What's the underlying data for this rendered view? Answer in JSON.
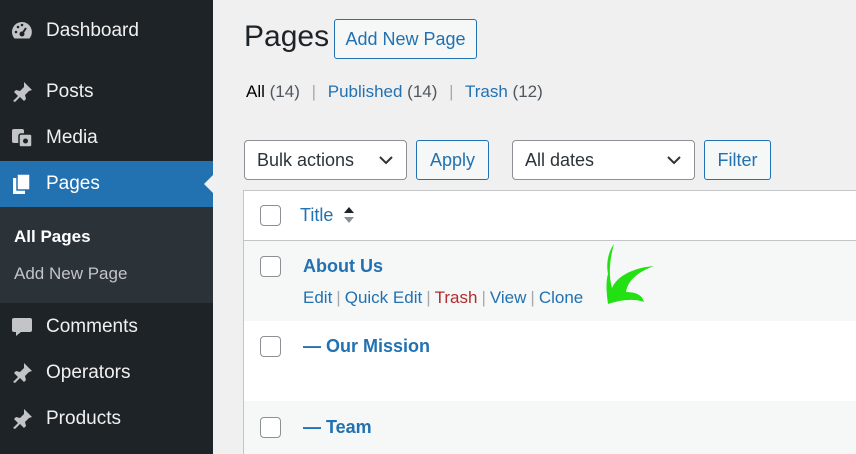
{
  "sidebar": {
    "items": [
      {
        "label": "Dashboard",
        "icon": "dashboard-icon"
      },
      {
        "label": "Posts",
        "icon": "pin-icon"
      },
      {
        "label": "Media",
        "icon": "media-icon"
      },
      {
        "label": "Pages",
        "icon": "pages-icon"
      },
      {
        "label": "Comments",
        "icon": "comment-icon"
      },
      {
        "label": "Operators",
        "icon": "pin-icon"
      },
      {
        "label": "Products",
        "icon": "pin-icon"
      }
    ],
    "submenu": [
      {
        "label": "All Pages"
      },
      {
        "label": "Add New Page"
      }
    ]
  },
  "header": {
    "title": "Pages",
    "add_new_label": "Add New Page"
  },
  "filters": {
    "all_label": "All",
    "all_count": "(14)",
    "published_label": "Published",
    "published_count": "(14)",
    "trash_label": "Trash",
    "trash_count": "(12)"
  },
  "toolbar": {
    "bulk_actions": "Bulk actions",
    "apply_label": "Apply",
    "dates": "All dates",
    "filter_label": "Filter"
  },
  "table": {
    "column_title": "Title",
    "rows": [
      {
        "title": "About Us"
      },
      {
        "title": "— Our Mission"
      },
      {
        "title": "— Team"
      }
    ],
    "row_actions": {
      "edit": "Edit",
      "quick_edit": "Quick Edit",
      "trash": "Trash",
      "view": "View",
      "clone": "Clone"
    }
  },
  "colors": {
    "sidebar_bg": "#1d2327",
    "active_bg": "#2271b1",
    "link": "#2271b1",
    "trash": "#b32d2e",
    "annotation_arrow": "#22e012"
  }
}
